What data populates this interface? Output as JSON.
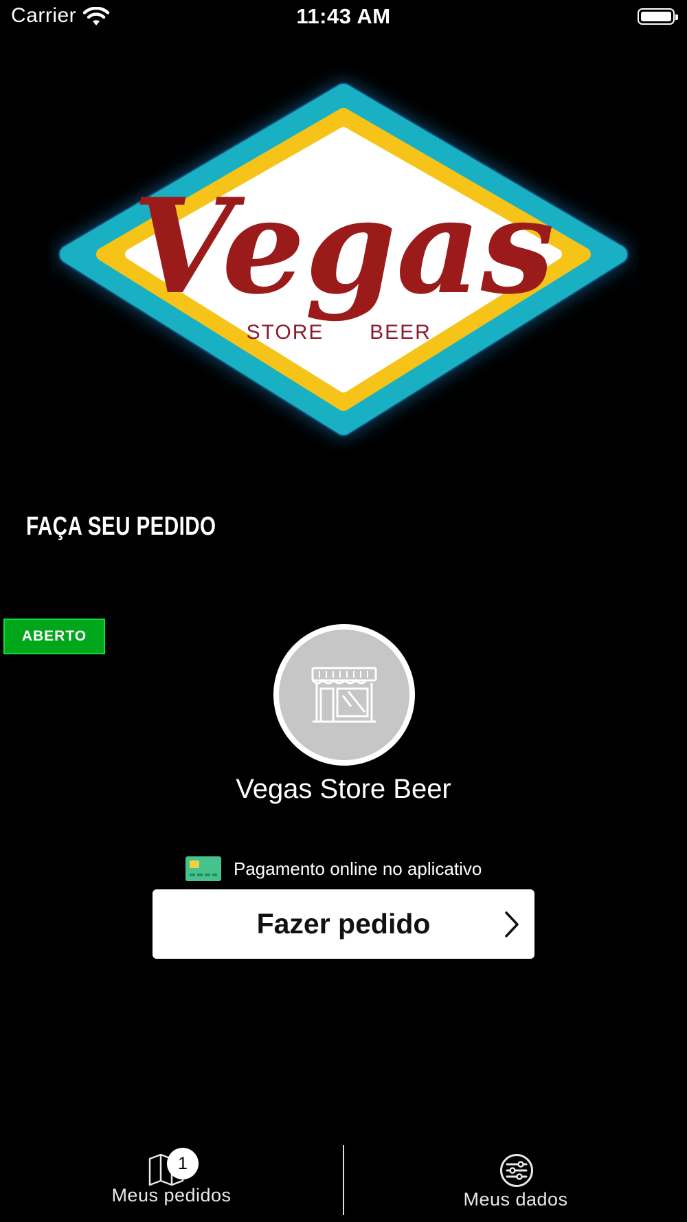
{
  "status_bar": {
    "carrier": "Carrier",
    "time": "11:43 AM"
  },
  "logo": {
    "script_text": "Vegas",
    "sub_left": "STORE",
    "sub_right": "BEER",
    "colors": {
      "outer": "#1ab0c4",
      "inner": "#f6c418",
      "text": "#9b1b1b"
    }
  },
  "page": {
    "heading": "FAÇA SEU PEDIDO"
  },
  "store": {
    "status_badge": "ABERTO",
    "name": "Vegas Store Beer",
    "avatar_icon": "storefront-icon",
    "payment_text": "Pagamento online no aplicativo",
    "payment_icon": "credit-card-icon",
    "order_button_label": "Fazer pedido"
  },
  "tabs": [
    {
      "label": "Meus pedidos",
      "icon": "map-icon",
      "badge": "1"
    },
    {
      "label": "Meus dados",
      "icon": "sliders-icon"
    }
  ],
  "colors": {
    "background": "#000000",
    "open_badge": "#00a71b",
    "card_icon": "#46c28c"
  }
}
